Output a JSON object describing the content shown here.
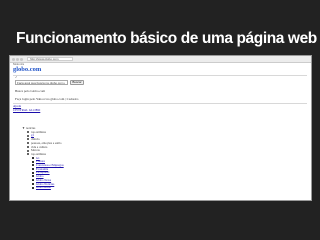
{
  "slide": {
    "title": "Funcionamento básico de uma página web"
  },
  "browser": {
    "url": "http://www.globo.com",
    "fold_label": "Menu site",
    "logo": "globo.com",
    "search_value": "Faça aqui sua busca na globo.com e na",
    "search_button": "Buscar",
    "section_heading": "Busca pelo Globo.com",
    "login_text": "Faça login pelo Yahoo! na globo.com | Cadastro",
    "nav_links": [
      "Ajuda",
      "CENTRAL GLOBO"
    ],
    "tree": [
      {
        "indent": 0,
        "marker": "tri",
        "text": "notícias",
        "link": false
      },
      {
        "indent": 1,
        "marker": "bullet",
        "text": "top estilistas",
        "link": false
      },
      {
        "indent": 1,
        "marker": "bullet",
        "text": "g1",
        "link": true
      },
      {
        "indent": 1,
        "marker": "bullet",
        "text": "ciência",
        "link": false
      },
      {
        "indent": 1,
        "marker": "bullet",
        "text": "pessoas, emoções e estilo",
        "link": false
      },
      {
        "indent": 1,
        "marker": "bullet",
        "text": "vida e cultura",
        "link": false
      },
      {
        "indent": 1,
        "marker": "bullet",
        "text": "Marcas",
        "link": false
      },
      {
        "indent": 1,
        "marker": "bullet",
        "text": "top estilistas",
        "link": false
      },
      {
        "indent": 2,
        "marker": "sq",
        "text": "G1",
        "link": true
      },
      {
        "indent": 2,
        "marker": "sq",
        "text": "Cultura",
        "link": true
      },
      {
        "indent": 2,
        "marker": "sq",
        "text": "Concursos e Empregos",
        "link": true
      },
      {
        "indent": 2,
        "marker": "sq",
        "text": "Economia",
        "link": true
      },
      {
        "indent": 2,
        "marker": "sq",
        "text": "Eu repórter",
        "link": true
      },
      {
        "indent": 2,
        "marker": "sq",
        "text": "Globo",
        "link": true
      },
      {
        "indent": 2,
        "marker": "sq",
        "text": "Globo News",
        "link": true
      },
      {
        "indent": 2,
        "marker": "sq",
        "text": "Globo Notícias",
        "link": true
      },
      {
        "indent": 2,
        "marker": "sq",
        "text": "Globo Rural",
        "link": true
      }
    ]
  }
}
